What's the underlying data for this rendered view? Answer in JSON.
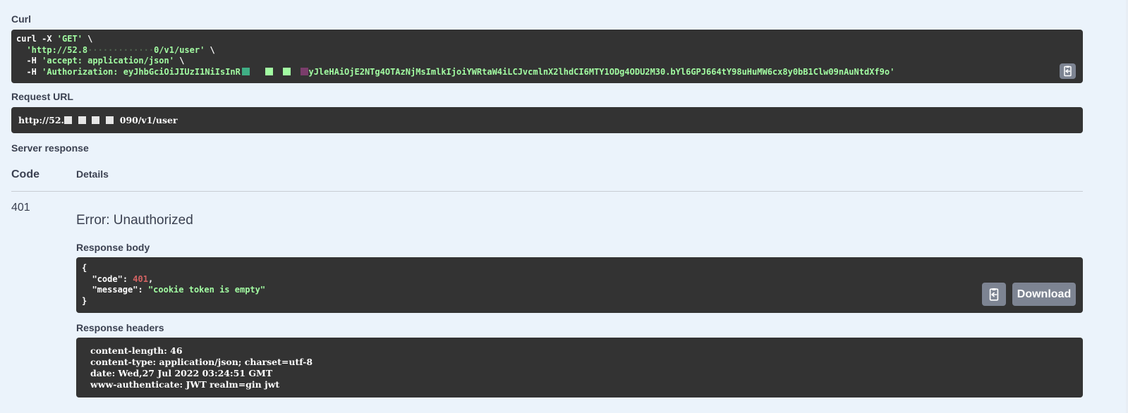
{
  "labels": {
    "curl": "Curl",
    "request_url": "Request URL",
    "server_response": "Server response",
    "code_header": "Code",
    "details_header": "Details",
    "response_body": "Response body",
    "response_headers": "Response headers"
  },
  "curl": {
    "line1_cmd": "curl -X ",
    "line1_method": "'GET'",
    "line1_tail": " \\",
    "line2_url_start": "'http://52.8",
    "line2_url_end": "0/v1/user'",
    "line2_tail": " \\",
    "line3_flag": "  -H ",
    "line3_value": "'accept: application/json'",
    "line3_tail": " \\",
    "line4_flag": "  -H ",
    "line4_value_start": "'Authorization: eyJhbGciOiJIUzI1NiIsInR",
    "line4_value_end": "yJleHAiOjE2NTg4OTAzNjMsImlkIjoiYWRtaW4iLCJvcmlnX2lhdCI6MTY1ODg4ODU2M30.bYl6GPJ664tY98uHuMW6cx8y0bB1Clw09nAuNtdXf9o'"
  },
  "request_url": {
    "start": "http://52.",
    "end": "090/v1/user"
  },
  "response": {
    "status_code": "401",
    "error_text": "Error: Unauthorized",
    "body": {
      "open": "{",
      "code_key": "\"code\"",
      "code_value": "401",
      "message_key": "\"message\"",
      "message_value": "\"cookie token is empty\"",
      "close": "}"
    },
    "headers": [
      "content-length: 46",
      "content-type: application/json; charset=utf-8",
      "date: Wed,27 Jul 2022 03:24:51 GMT",
      "www-authenticate: JWT realm=gin jwt"
    ],
    "download_label": "Download"
  },
  "icons": {
    "copy": "clipboard-copy-icon"
  },
  "colors": {
    "background": "#ebf3fb",
    "code_background": "#333333",
    "string_green": "#a2fca2",
    "number_red": "#d36363",
    "button_gray": "#7d8492"
  }
}
